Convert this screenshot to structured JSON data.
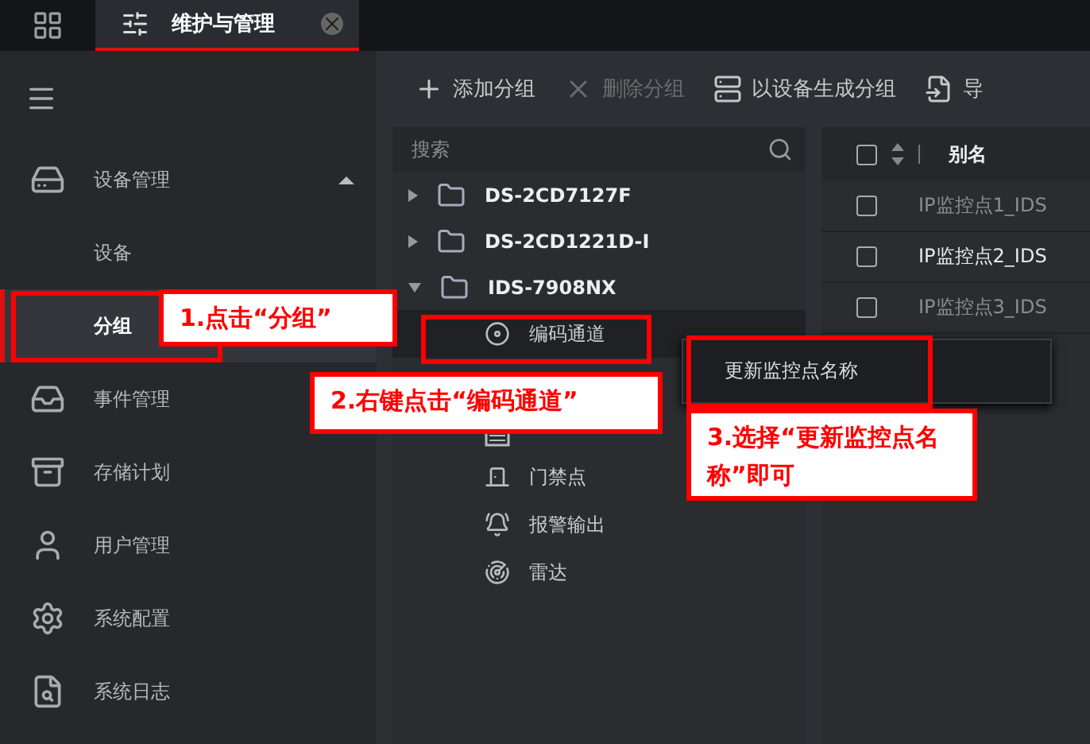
{
  "tabs": [
    {
      "label": "维护与管理",
      "selected": true
    }
  ],
  "sidebar": {
    "items": [
      {
        "kind": "group",
        "label": "设备管理",
        "expanded": true,
        "selected": false
      },
      {
        "kind": "sub",
        "label": "设备",
        "selected": false
      },
      {
        "kind": "sub",
        "label": "分组",
        "selected": true
      },
      {
        "kind": "group",
        "label": "事件管理",
        "expanded": false,
        "selected": false
      },
      {
        "kind": "group",
        "label": "存储计划",
        "expanded": false,
        "selected": false
      },
      {
        "kind": "group",
        "label": "用户管理",
        "expanded": false,
        "selected": false
      },
      {
        "kind": "group",
        "label": "系统配置",
        "expanded": false,
        "selected": false
      },
      {
        "kind": "group",
        "label": "系统日志",
        "expanded": false,
        "selected": false
      }
    ]
  },
  "toolbar": [
    {
      "label": "添加分组",
      "disabled": false
    },
    {
      "label": "删除分组",
      "disabled": true
    },
    {
      "label": "以设备生成分组",
      "disabled": false
    },
    {
      "label": "导",
      "disabled": false
    }
  ],
  "search": {
    "placeholder": "搜索"
  },
  "tree": [
    {
      "label": "DS-2CD7127F",
      "expanded": false
    },
    {
      "label": "DS-2CD1221D-I",
      "expanded": false
    },
    {
      "label": "IDS-7908NX",
      "expanded": true,
      "children": [
        {
          "label": "编码通道",
          "selected": true
        },
        {
          "selected": false
        },
        {
          "label": "门禁点",
          "selected": false
        },
        {
          "label": "报警输出",
          "selected": false
        },
        {
          "label": "雷达",
          "selected": false
        }
      ]
    }
  ],
  "table": {
    "columns": [
      "别名"
    ],
    "header_checked": false,
    "rows": [
      {
        "alias": "IP监控点1_IDS",
        "checked": false,
        "highlighted": false
      },
      {
        "alias": "IP监控点2_IDS",
        "checked": false,
        "highlighted": true
      },
      {
        "alias": "IP监控点3_IDS",
        "checked": false,
        "highlighted": false
      }
    ]
  },
  "context_menu": {
    "items": [
      "更新监控点名称"
    ]
  },
  "annotations": [
    "1.点击“分组”",
    "2.右键点击“编码通道”",
    "3.选择“更新监控点名称”即可"
  ]
}
